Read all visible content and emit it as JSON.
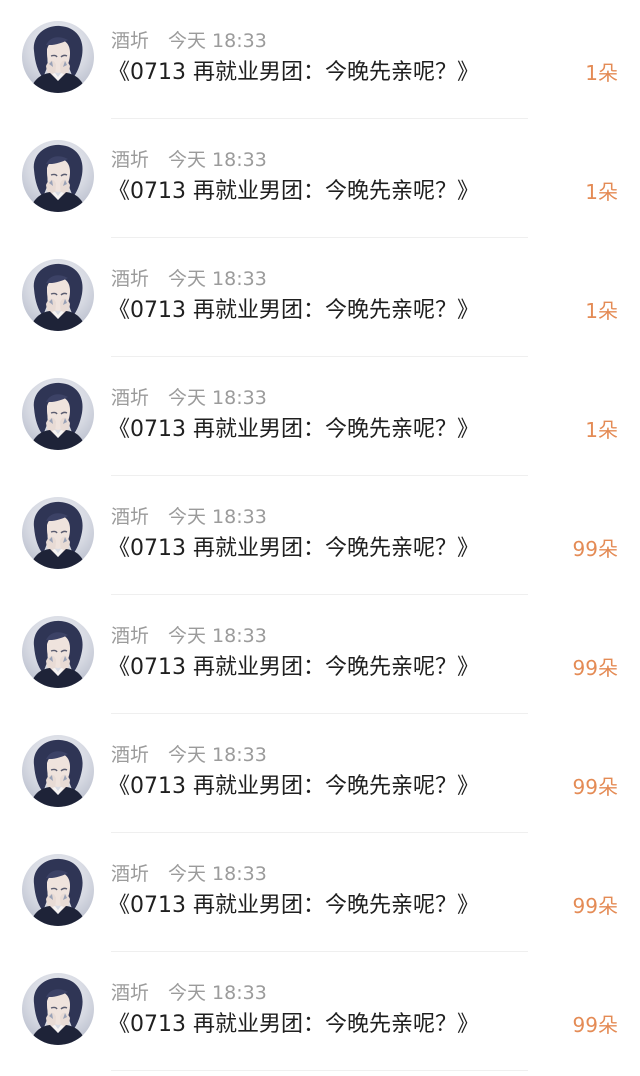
{
  "gifts": [
    {
      "username": "酒圻",
      "time": "今天 18:33",
      "title": "《0713 再就业男团：今晚先亲呢？》",
      "count": "1朵"
    },
    {
      "username": "酒圻",
      "time": "今天 18:33",
      "title": "《0713 再就业男团：今晚先亲呢？》",
      "count": "1朵"
    },
    {
      "username": "酒圻",
      "time": "今天 18:33",
      "title": "《0713 再就业男团：今晚先亲呢？》",
      "count": "1朵"
    },
    {
      "username": "酒圻",
      "time": "今天 18:33",
      "title": "《0713 再就业男团：今晚先亲呢？》",
      "count": "1朵"
    },
    {
      "username": "酒圻",
      "time": "今天 18:33",
      "title": "《0713 再就业男团：今晚先亲呢？》",
      "count": "99朵"
    },
    {
      "username": "酒圻",
      "time": "今天 18:33",
      "title": "《0713 再就业男团：今晚先亲呢？》",
      "count": "99朵"
    },
    {
      "username": "酒圻",
      "time": "今天 18:33",
      "title": "《0713 再就业男团：今晚先亲呢？》",
      "count": "99朵"
    },
    {
      "username": "酒圻",
      "time": "今天 18:33",
      "title": "《0713 再就业男团：今晚先亲呢？》",
      "count": "99朵"
    },
    {
      "username": "酒圻",
      "time": "今天 18:33",
      "title": "《0713 再就业男团：今晚先亲呢？》",
      "count": "99朵"
    }
  ],
  "colors": {
    "meta_text": "#9b9b9b",
    "title_text": "#1f1f1f",
    "count_accent": "#e48b55",
    "divider": "#efefef"
  },
  "avatar_icon": "avatar-portrait-icon"
}
